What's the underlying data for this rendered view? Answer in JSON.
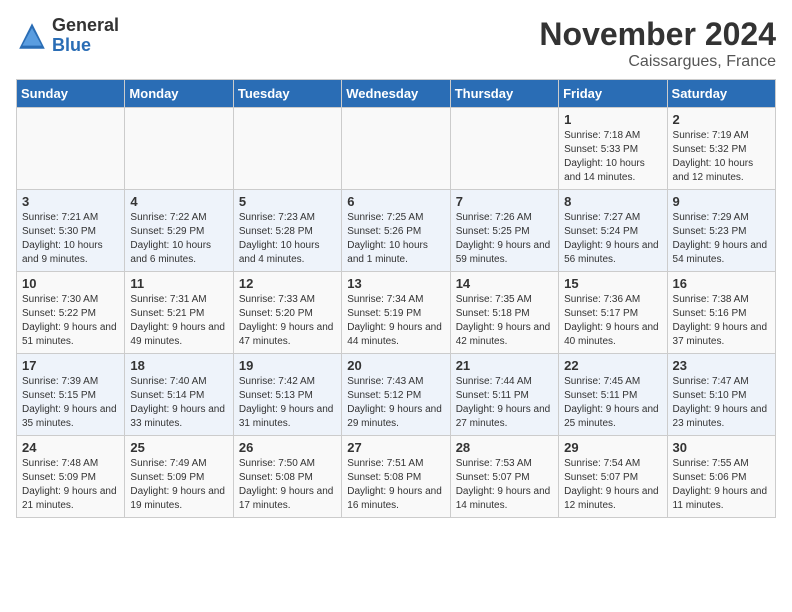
{
  "header": {
    "logo_general": "General",
    "logo_blue": "Blue",
    "month_title": "November 2024",
    "location": "Caissargues, France"
  },
  "weekdays": [
    "Sunday",
    "Monday",
    "Tuesday",
    "Wednesday",
    "Thursday",
    "Friday",
    "Saturday"
  ],
  "weeks": [
    [
      {
        "day": "",
        "info": ""
      },
      {
        "day": "",
        "info": ""
      },
      {
        "day": "",
        "info": ""
      },
      {
        "day": "",
        "info": ""
      },
      {
        "day": "",
        "info": ""
      },
      {
        "day": "1",
        "info": "Sunrise: 7:18 AM\nSunset: 5:33 PM\nDaylight: 10 hours and 14 minutes."
      },
      {
        "day": "2",
        "info": "Sunrise: 7:19 AM\nSunset: 5:32 PM\nDaylight: 10 hours and 12 minutes."
      }
    ],
    [
      {
        "day": "3",
        "info": "Sunrise: 7:21 AM\nSunset: 5:30 PM\nDaylight: 10 hours and 9 minutes."
      },
      {
        "day": "4",
        "info": "Sunrise: 7:22 AM\nSunset: 5:29 PM\nDaylight: 10 hours and 6 minutes."
      },
      {
        "day": "5",
        "info": "Sunrise: 7:23 AM\nSunset: 5:28 PM\nDaylight: 10 hours and 4 minutes."
      },
      {
        "day": "6",
        "info": "Sunrise: 7:25 AM\nSunset: 5:26 PM\nDaylight: 10 hours and 1 minute."
      },
      {
        "day": "7",
        "info": "Sunrise: 7:26 AM\nSunset: 5:25 PM\nDaylight: 9 hours and 59 minutes."
      },
      {
        "day": "8",
        "info": "Sunrise: 7:27 AM\nSunset: 5:24 PM\nDaylight: 9 hours and 56 minutes."
      },
      {
        "day": "9",
        "info": "Sunrise: 7:29 AM\nSunset: 5:23 PM\nDaylight: 9 hours and 54 minutes."
      }
    ],
    [
      {
        "day": "10",
        "info": "Sunrise: 7:30 AM\nSunset: 5:22 PM\nDaylight: 9 hours and 51 minutes."
      },
      {
        "day": "11",
        "info": "Sunrise: 7:31 AM\nSunset: 5:21 PM\nDaylight: 9 hours and 49 minutes."
      },
      {
        "day": "12",
        "info": "Sunrise: 7:33 AM\nSunset: 5:20 PM\nDaylight: 9 hours and 47 minutes."
      },
      {
        "day": "13",
        "info": "Sunrise: 7:34 AM\nSunset: 5:19 PM\nDaylight: 9 hours and 44 minutes."
      },
      {
        "day": "14",
        "info": "Sunrise: 7:35 AM\nSunset: 5:18 PM\nDaylight: 9 hours and 42 minutes."
      },
      {
        "day": "15",
        "info": "Sunrise: 7:36 AM\nSunset: 5:17 PM\nDaylight: 9 hours and 40 minutes."
      },
      {
        "day": "16",
        "info": "Sunrise: 7:38 AM\nSunset: 5:16 PM\nDaylight: 9 hours and 37 minutes."
      }
    ],
    [
      {
        "day": "17",
        "info": "Sunrise: 7:39 AM\nSunset: 5:15 PM\nDaylight: 9 hours and 35 minutes."
      },
      {
        "day": "18",
        "info": "Sunrise: 7:40 AM\nSunset: 5:14 PM\nDaylight: 9 hours and 33 minutes."
      },
      {
        "day": "19",
        "info": "Sunrise: 7:42 AM\nSunset: 5:13 PM\nDaylight: 9 hours and 31 minutes."
      },
      {
        "day": "20",
        "info": "Sunrise: 7:43 AM\nSunset: 5:12 PM\nDaylight: 9 hours and 29 minutes."
      },
      {
        "day": "21",
        "info": "Sunrise: 7:44 AM\nSunset: 5:11 PM\nDaylight: 9 hours and 27 minutes."
      },
      {
        "day": "22",
        "info": "Sunrise: 7:45 AM\nSunset: 5:11 PM\nDaylight: 9 hours and 25 minutes."
      },
      {
        "day": "23",
        "info": "Sunrise: 7:47 AM\nSunset: 5:10 PM\nDaylight: 9 hours and 23 minutes."
      }
    ],
    [
      {
        "day": "24",
        "info": "Sunrise: 7:48 AM\nSunset: 5:09 PM\nDaylight: 9 hours and 21 minutes."
      },
      {
        "day": "25",
        "info": "Sunrise: 7:49 AM\nSunset: 5:09 PM\nDaylight: 9 hours and 19 minutes."
      },
      {
        "day": "26",
        "info": "Sunrise: 7:50 AM\nSunset: 5:08 PM\nDaylight: 9 hours and 17 minutes."
      },
      {
        "day": "27",
        "info": "Sunrise: 7:51 AM\nSunset: 5:08 PM\nDaylight: 9 hours and 16 minutes."
      },
      {
        "day": "28",
        "info": "Sunrise: 7:53 AM\nSunset: 5:07 PM\nDaylight: 9 hours and 14 minutes."
      },
      {
        "day": "29",
        "info": "Sunrise: 7:54 AM\nSunset: 5:07 PM\nDaylight: 9 hours and 12 minutes."
      },
      {
        "day": "30",
        "info": "Sunrise: 7:55 AM\nSunset: 5:06 PM\nDaylight: 9 hours and 11 minutes."
      }
    ]
  ]
}
